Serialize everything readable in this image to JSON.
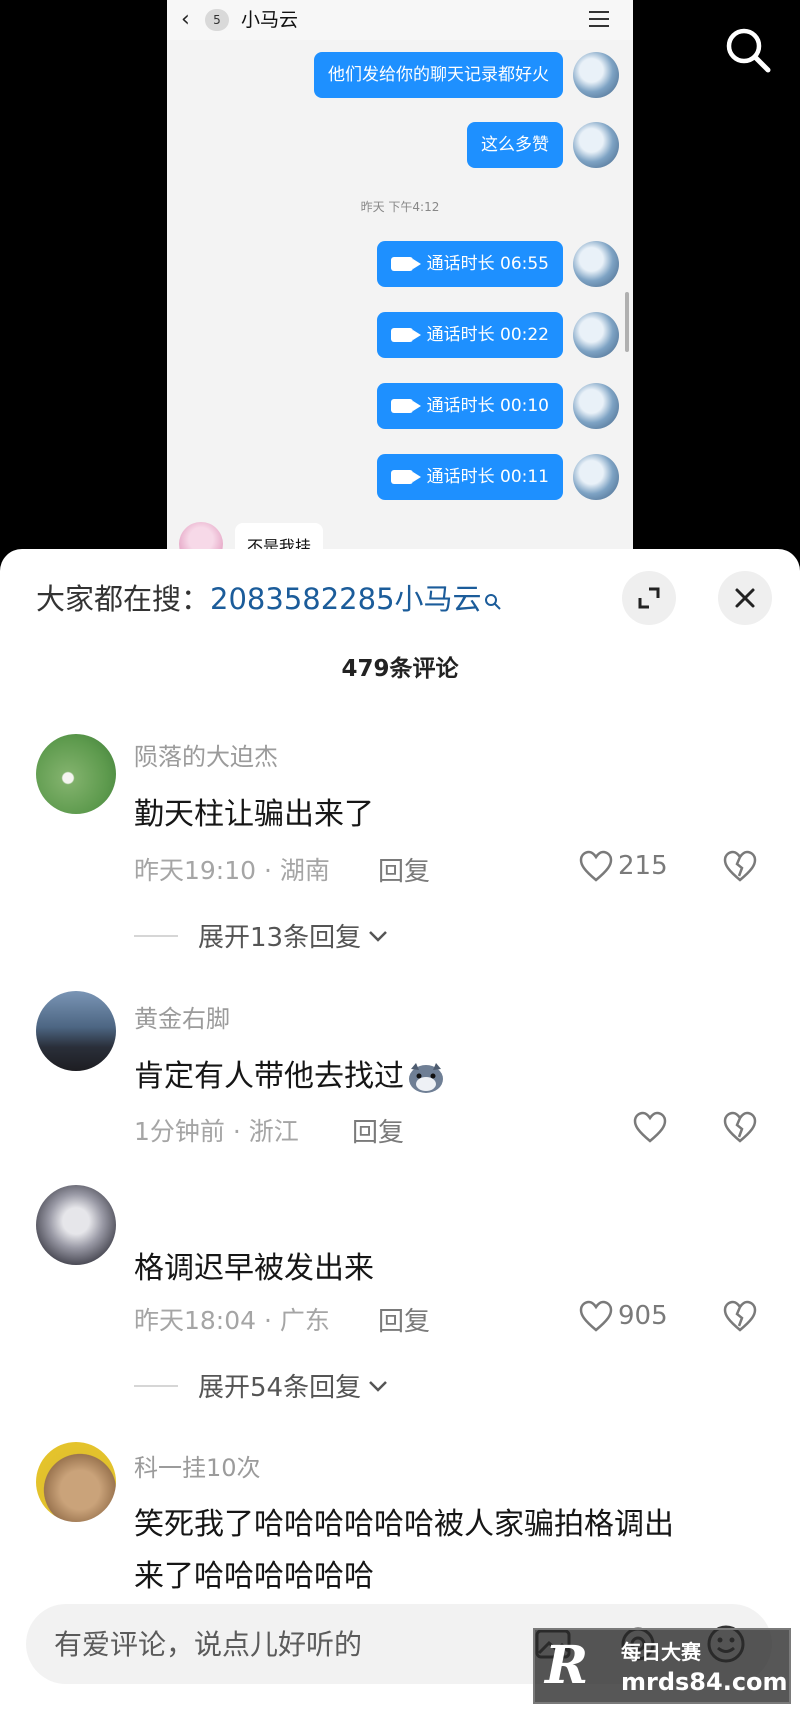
{
  "chat": {
    "unread_count": "5",
    "contact_name": "小马云",
    "messages": [
      {
        "text": "他们发给你的聊天记录都好火"
      },
      {
        "text": "这么多赞"
      }
    ],
    "timestamp": "昨天 下午4:12",
    "calls": [
      {
        "label": "通话时长 06:55"
      },
      {
        "label": "通话时长 00:22"
      },
      {
        "label": "通话时长 00:10"
      },
      {
        "label": "通话时长 00:11"
      }
    ],
    "peer_message": "不是我挂"
  },
  "sheet": {
    "search_prefix": "大家都在搜：",
    "search_keyword": "2083582285小马云",
    "comment_count": "479条评论"
  },
  "comments": [
    {
      "user": "陨落的大迫杰",
      "text": "勤天柱让骗出来了",
      "meta": "昨天19:10 · 湖南",
      "reply": "回复",
      "likes": "215",
      "expand": "展开13条回复"
    },
    {
      "user": "黄金右脚",
      "text": "肯定有人带他去找过",
      "meta": "1分钟前 · 浙江",
      "reply": "回复",
      "likes": ""
    },
    {
      "user": "",
      "text": "格调迟早被发出来",
      "meta": "昨天18:04 · 广东",
      "reply": "回复",
      "likes": "905",
      "expand": "展开54条回复"
    },
    {
      "user": "科一挂10次",
      "text_line1": "笑死我了哈哈哈哈哈哈被人家骗拍格调出",
      "text_line2": "来了哈哈哈哈哈哈"
    }
  ],
  "input": {
    "placeholder": "有爱评论，说点儿好听的"
  },
  "watermark": {
    "logo_letter": "R",
    "line1": "每日大赛",
    "line2": "mrds84.com"
  },
  "colors": {
    "bubble_blue": "#1e90ff",
    "keyword_blue": "#1b5c9a",
    "sheet_bg": "#ffffff",
    "background": "#000000"
  }
}
